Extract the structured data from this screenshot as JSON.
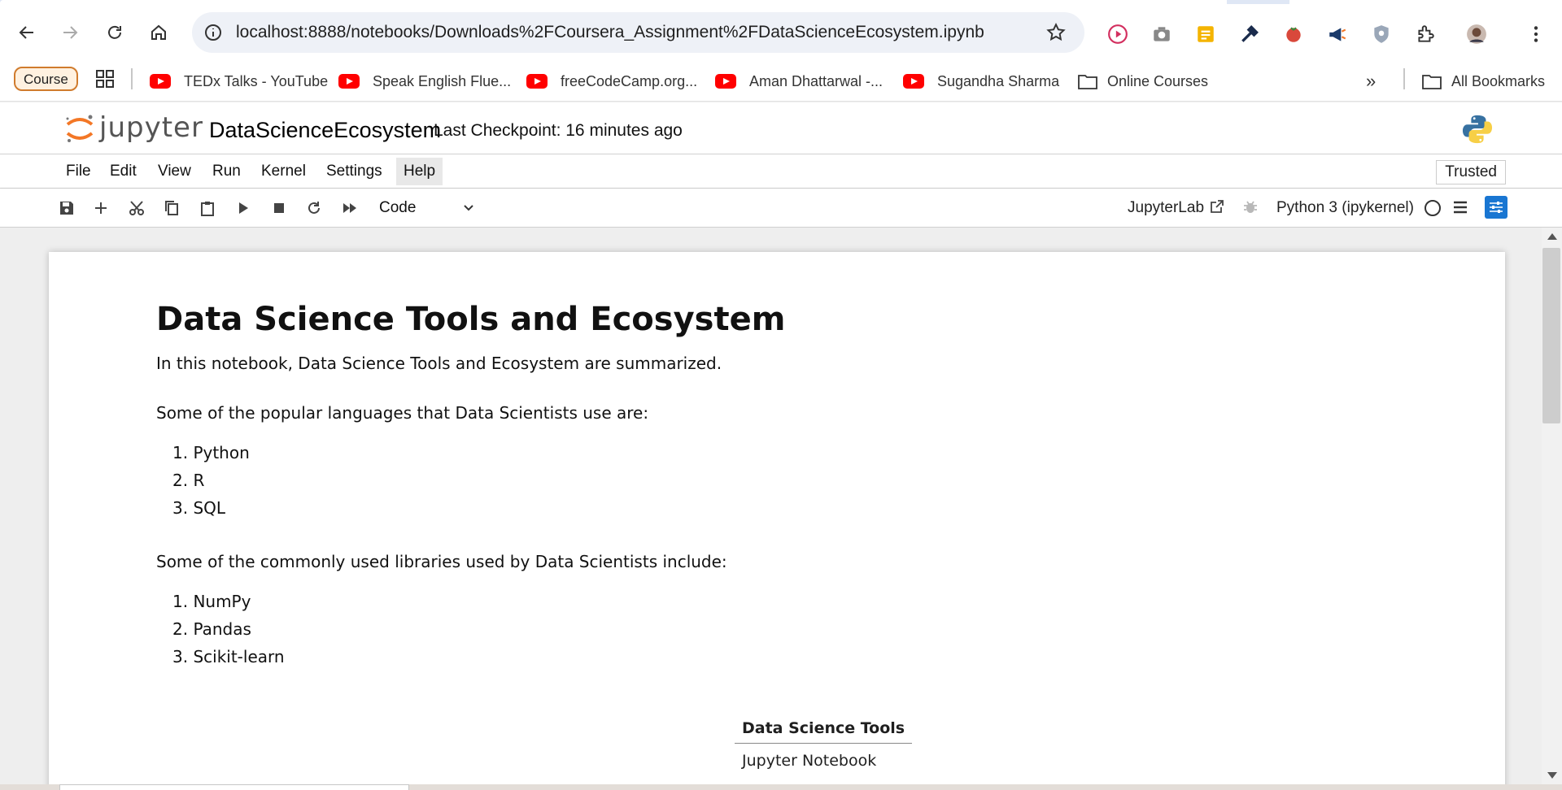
{
  "browser": {
    "url": "localhost:8888/notebooks/Downloads%2FCoursera_Assignment%2FDataScienceEcosystem.ipynb",
    "bookmarks": {
      "course_chip": "Course",
      "items": [
        {
          "label": "TEDx Talks - YouTube",
          "icon": "youtube-icon"
        },
        {
          "label": "Speak English Flue...",
          "icon": "youtube-icon"
        },
        {
          "label": "freeCodeCamp.org...",
          "icon": "youtube-icon"
        },
        {
          "label": "Aman Dhattarwal -...",
          "icon": "youtube-icon"
        },
        {
          "label": "Sugandha Sharma",
          "icon": "youtube-icon"
        },
        {
          "label": "Online Courses",
          "icon": "folder-icon"
        }
      ],
      "overflow": "»",
      "all_bookmarks": "All Bookmarks"
    }
  },
  "jupyter": {
    "logo_text": "jupyter",
    "notebook_name": "DataScienceEcosystem",
    "checkpoint": "Last Checkpoint: 16 minutes ago",
    "menu": [
      "File",
      "Edit",
      "View",
      "Run",
      "Kernel",
      "Settings",
      "Help"
    ],
    "active_menu": "Help",
    "trusted": "Trusted",
    "cell_type": "Code",
    "jupyterlab_link": "JupyterLab",
    "kernel": "Python 3 (ipykernel)",
    "accent": "#f37726",
    "prop_accent": "#1976d2"
  },
  "notebook": {
    "title": "Data Science Tools and Ecosystem",
    "intro": "In this notebook, Data Science Tools and Ecosystem are summarized.",
    "languages_intro": "Some of the popular languages that Data Scientists use are:",
    "languages": [
      "1. Python",
      "2. R",
      "3. SQL"
    ],
    "libraries_intro": "Some of the commonly used libraries used by Data Scientists include:",
    "libraries": [
      "1. NumPy",
      "2. Pandas",
      "3. Scikit-learn"
    ],
    "tools_table": {
      "header": "Data Science Tools",
      "rows": [
        "Jupyter Notebook"
      ]
    }
  }
}
